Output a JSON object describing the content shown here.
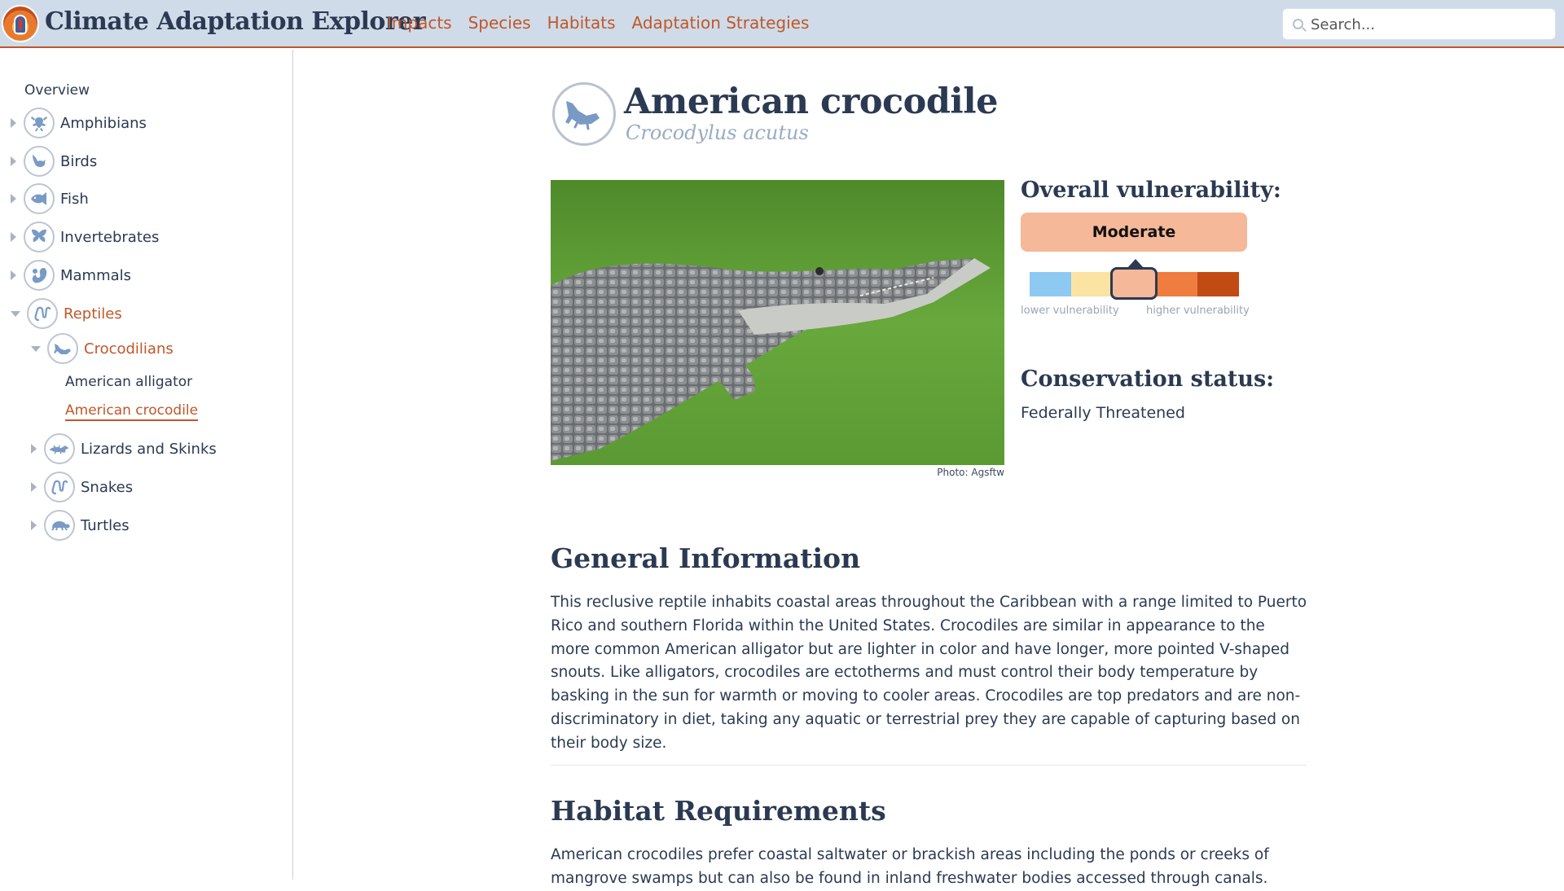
{
  "header": {
    "app_title": "Climate Adaptation Explorer",
    "nav": [
      "Impacts",
      "Species",
      "Habitats",
      "Adaptation Strategies"
    ],
    "search_placeholder": "Search..."
  },
  "sidebar": {
    "overview": "Overview",
    "categories": [
      {
        "label": "Amphibians",
        "icon": "frog-icon"
      },
      {
        "label": "Birds",
        "icon": "bird-icon"
      },
      {
        "label": "Fish",
        "icon": "fish-icon"
      },
      {
        "label": "Invertebrates",
        "icon": "butterfly-icon"
      },
      {
        "label": "Mammals",
        "icon": "squirrel-icon"
      },
      {
        "label": "Reptiles",
        "icon": "snake-icon",
        "expanded": true
      }
    ],
    "reptile_groups": [
      {
        "label": "Crocodilians",
        "icon": "crocodile-icon",
        "expanded": true
      },
      {
        "label": "Lizards and Skinks",
        "icon": "lizard-icon"
      },
      {
        "label": "Snakes",
        "icon": "snake-icon"
      },
      {
        "label": "Turtles",
        "icon": "turtle-icon"
      }
    ],
    "crocodilians": [
      "American alligator",
      "American crocodile"
    ],
    "current": "American crocodile"
  },
  "species": {
    "common_name": "American crocodile",
    "scientific_name": "Crocodylus acutus",
    "photo_credit": "Photo: Agsftw",
    "vulnerability": {
      "title": "Overall vulnerability:",
      "level": "Moderate",
      "scale_colors": [
        "#8ec9f2",
        "#fbe3a4",
        "#f5b898",
        "#ee7d3f",
        "#c24b14"
      ],
      "current_index": 2,
      "low_label": "lower vulnerability",
      "high_label": "higher vulnerability"
    },
    "conservation": {
      "title": "Conservation status:",
      "status": "Federally Threatened"
    }
  },
  "sections": [
    {
      "heading": "General Information",
      "body": "This reclusive reptile inhabits coastal areas throughout the Caribbean with a range limited to Puerto Rico and southern Florida within the United States. Crocodiles are similar in appearance to the more common American alligator but are lighter in color and have longer, more pointed V-shaped snouts. Like alligators, crocodiles are ectotherms and must control their body temperature by basking in the sun for warmth or moving to cooler areas. Crocodiles are top predators and are non-discriminatory in diet, taking any aquatic or terrestrial prey they are capable of capturing based on their body size."
    },
    {
      "heading": "Habitat Requirements",
      "body": "American crocodiles prefer coastal saltwater or brackish areas including the ponds or creeks of mangrove swamps but can also be found in inland freshwater bodies accessed through canals."
    }
  ]
}
